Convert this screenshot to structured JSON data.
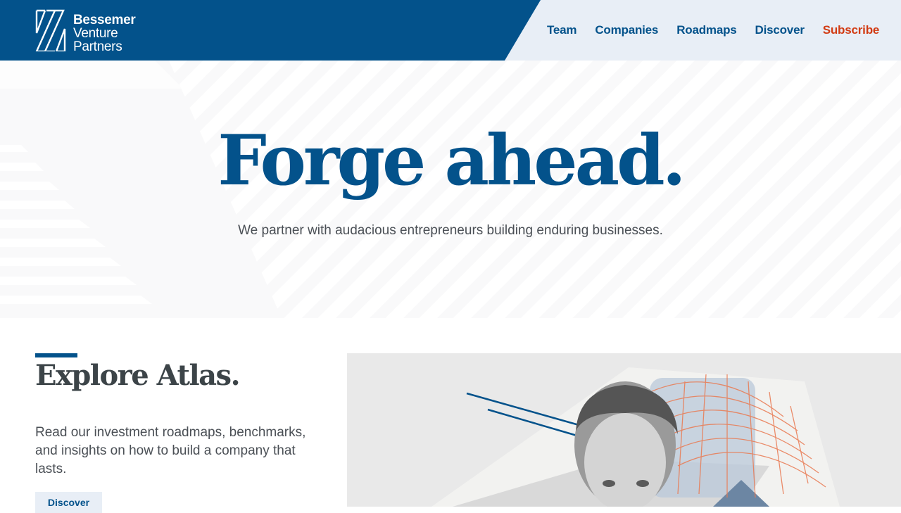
{
  "header": {
    "logo_lines": [
      "Bessemer",
      "Venture",
      "Partners"
    ],
    "nav": [
      "Team",
      "Companies",
      "Roadmaps",
      "Discover",
      "Subscribe"
    ]
  },
  "hero": {
    "title": "Forge ahead.",
    "subtitle": "We partner with audacious entrepreneurs building enduring businesses."
  },
  "atlas": {
    "title": "Explore Atlas.",
    "description": "Read our investment roadmaps, benchmarks, and insights on how to build a company that lasts.",
    "button_label": "Discover"
  },
  "colors": {
    "brand_blue": "#03528b",
    "subscribe_red": "#d23b13",
    "nav_bg": "#e8eef6"
  }
}
